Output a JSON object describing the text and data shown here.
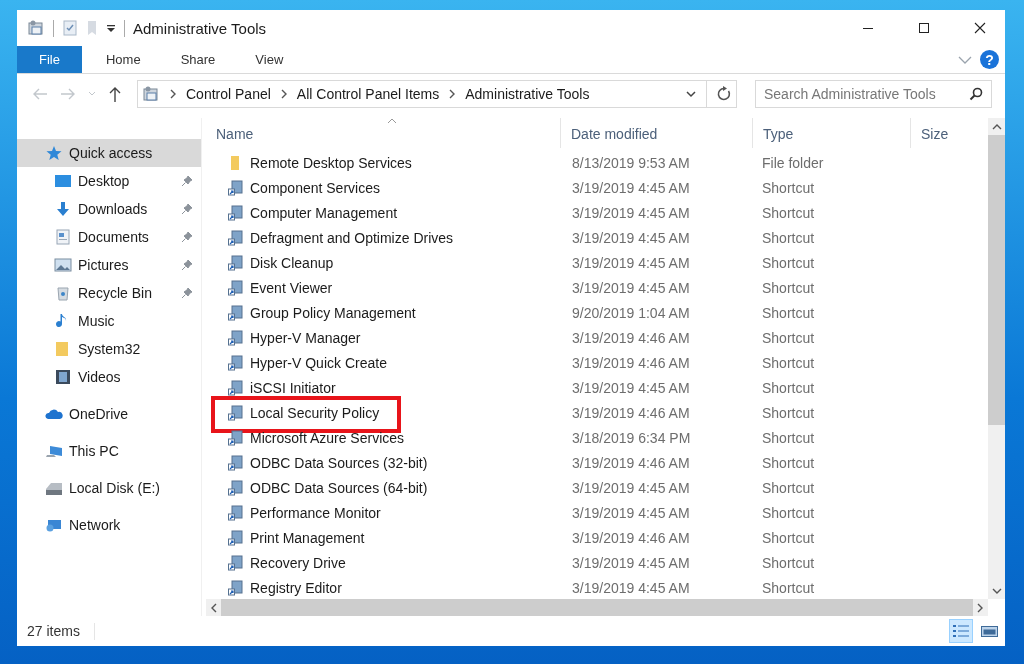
{
  "window": {
    "title": "Administrative Tools"
  },
  "ribbon": {
    "tabs": [
      {
        "label": "File",
        "selected": true
      },
      {
        "label": "Home",
        "selected": false
      },
      {
        "label": "Share",
        "selected": false
      },
      {
        "label": "View",
        "selected": false
      }
    ],
    "help": "?"
  },
  "address": {
    "crumbs": [
      "Control Panel",
      "All Control Panel Items",
      "Administrative Tools"
    ]
  },
  "search": {
    "placeholder": "Search Administrative Tools"
  },
  "sidebar": {
    "items": [
      {
        "label": "Quick access",
        "selected": true,
        "children": [
          {
            "label": "Desktop",
            "pinned": true
          },
          {
            "label": "Downloads",
            "pinned": true
          },
          {
            "label": "Documents",
            "pinned": true
          },
          {
            "label": "Pictures",
            "pinned": true
          },
          {
            "label": "Recycle Bin",
            "pinned": true
          },
          {
            "label": "Music",
            "pinned": false
          },
          {
            "label": "System32",
            "pinned": false
          },
          {
            "label": "Videos",
            "pinned": false
          }
        ]
      },
      {
        "label": "OneDrive",
        "selected": false
      },
      {
        "label": "This PC",
        "selected": false
      },
      {
        "label": "Local Disk (E:)",
        "selected": false
      },
      {
        "label": "Network",
        "selected": false
      }
    ]
  },
  "table": {
    "columns": [
      "Name",
      "Date modified",
      "Type",
      "Size"
    ],
    "rows": [
      {
        "name": "Remote Desktop Services",
        "date": "8/13/2019 9:53 AM",
        "type": "File folder",
        "kind": "folder",
        "highlighted": false
      },
      {
        "name": "Component Services",
        "date": "3/19/2019 4:45 AM",
        "type": "Shortcut",
        "kind": "shortcut",
        "highlighted": false
      },
      {
        "name": "Computer Management",
        "date": "3/19/2019 4:45 AM",
        "type": "Shortcut",
        "kind": "shortcut",
        "highlighted": false
      },
      {
        "name": "Defragment and Optimize Drives",
        "date": "3/19/2019 4:45 AM",
        "type": "Shortcut",
        "kind": "shortcut",
        "highlighted": false
      },
      {
        "name": "Disk Cleanup",
        "date": "3/19/2019 4:45 AM",
        "type": "Shortcut",
        "kind": "shortcut",
        "highlighted": false
      },
      {
        "name": "Event Viewer",
        "date": "3/19/2019 4:45 AM",
        "type": "Shortcut",
        "kind": "shortcut",
        "highlighted": false
      },
      {
        "name": "Group Policy Management",
        "date": "9/20/2019 1:04 AM",
        "type": "Shortcut",
        "kind": "shortcut",
        "highlighted": false
      },
      {
        "name": "Hyper-V Manager",
        "date": "3/19/2019 4:46 AM",
        "type": "Shortcut",
        "kind": "shortcut",
        "highlighted": false
      },
      {
        "name": "Hyper-V Quick Create",
        "date": "3/19/2019 4:46 AM",
        "type": "Shortcut",
        "kind": "shortcut",
        "highlighted": false
      },
      {
        "name": "iSCSI Initiator",
        "date": "3/19/2019 4:45 AM",
        "type": "Shortcut",
        "kind": "shortcut",
        "highlighted": false
      },
      {
        "name": "Local Security Policy",
        "date": "3/19/2019 4:46 AM",
        "type": "Shortcut",
        "kind": "shortcut",
        "highlighted": true
      },
      {
        "name": "Microsoft Azure Services",
        "date": "3/18/2019 6:34 PM",
        "type": "Shortcut",
        "kind": "shortcut",
        "highlighted": false
      },
      {
        "name": "ODBC Data Sources (32-bit)",
        "date": "3/19/2019 4:46 AM",
        "type": "Shortcut",
        "kind": "shortcut",
        "highlighted": false
      },
      {
        "name": "ODBC Data Sources (64-bit)",
        "date": "3/19/2019 4:45 AM",
        "type": "Shortcut",
        "kind": "shortcut",
        "highlighted": false
      },
      {
        "name": "Performance Monitor",
        "date": "3/19/2019 4:45 AM",
        "type": "Shortcut",
        "kind": "shortcut",
        "highlighted": false
      },
      {
        "name": "Print Management",
        "date": "3/19/2019 4:46 AM",
        "type": "Shortcut",
        "kind": "shortcut",
        "highlighted": false
      },
      {
        "name": "Recovery Drive",
        "date": "3/19/2019 4:45 AM",
        "type": "Shortcut",
        "kind": "shortcut",
        "highlighted": false
      },
      {
        "name": "Registry Editor",
        "date": "3/19/2019 4:45 AM",
        "type": "Shortcut",
        "kind": "shortcut",
        "highlighted": false
      }
    ]
  },
  "status_bar": {
    "count": "27 items",
    "views": [
      {
        "selected": true
      },
      {
        "selected": false
      }
    ]
  }
}
